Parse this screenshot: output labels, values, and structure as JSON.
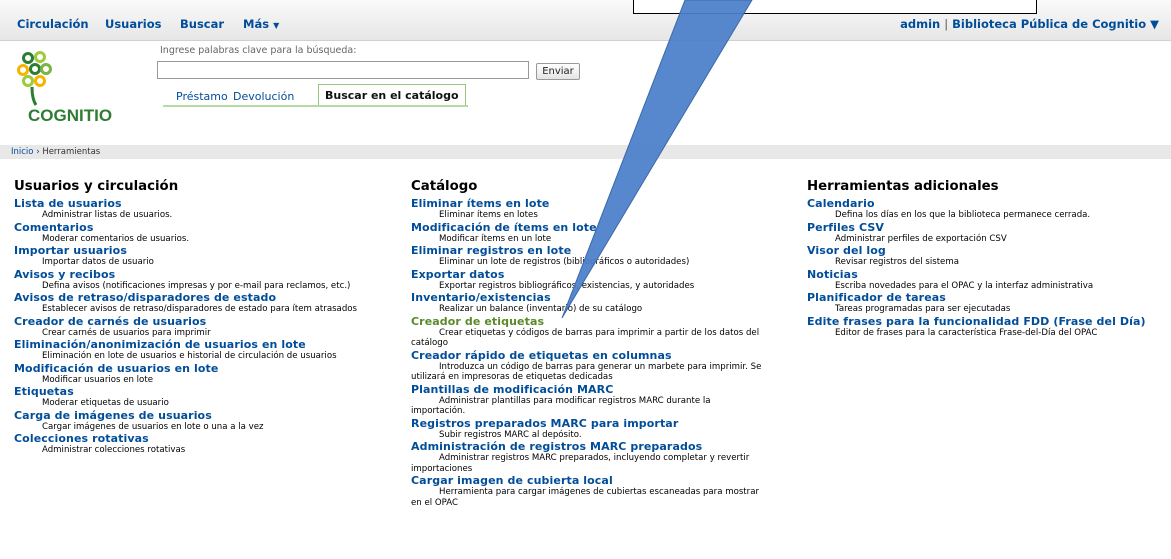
{
  "nav": {
    "circulacion": "Circulación",
    "usuarios": "Usuarios",
    "buscar": "Buscar",
    "mas": "Más",
    "user": "admin",
    "separator": "|",
    "library": "Biblioteca Pública de Cognitio"
  },
  "header": {
    "logo_text": "COGNITIO",
    "search_hint": "Ingrese palabras clave para la búsqueda:",
    "search_value": "",
    "submit": "Enviar",
    "tabs": [
      "Préstamo",
      "Devolución",
      "Buscar en el catálogo"
    ]
  },
  "breadcrumb": {
    "home": "Inicio",
    "sep": "›",
    "current": "Herramientas"
  },
  "columns": [
    {
      "title": "Usuarios y circulación",
      "items": [
        {
          "label": "Lista de usuarios",
          "desc": "Administrar listas de usuarios."
        },
        {
          "label": "Comentarios",
          "desc": "Moderar comentarios de usuarios."
        },
        {
          "label": "Importar usuarios",
          "desc": "Importar datos de usuario"
        },
        {
          "label": "Avisos y recibos",
          "desc": "Defina avisos (notificaciones impresas y por e-mail para reclamos, etc.)"
        },
        {
          "label": "Avisos de retraso/disparadores de estado",
          "desc": "Establecer avisos de retraso/disparadores de estado para ítem atrasados"
        },
        {
          "label": "Creador de carnés de usuarios",
          "desc": "Crear carnés de usuarios para imprimir"
        },
        {
          "label": "Eliminación/anonimización de usuarios en lote",
          "desc": "Eliminación en lote de usuarios e historial de circulación de usuarios"
        },
        {
          "label": "Modificación de usuarios en lote",
          "desc": "Modificar usuarios en lote"
        },
        {
          "label": "Etiquetas",
          "desc": "Moderar etiquetas de usuario"
        },
        {
          "label": "Carga de imágenes de usuarios",
          "desc": "Cargar imágenes de usuarios en lote o una a la vez"
        },
        {
          "label": "Colecciones rotativas",
          "desc": "Administrar colecciones rotativas"
        }
      ]
    },
    {
      "title": "Catálogo",
      "items": [
        {
          "label": "Eliminar ítems en lote",
          "desc": "Eliminar ítems en lotes"
        },
        {
          "label": "Modificación de ítems en lote",
          "desc": "Modificar ítems en un lote"
        },
        {
          "label": "Eliminar registros en lote",
          "desc": "Eliminar un lote de registros (bibliográficos o autoridades)"
        },
        {
          "label": "Exportar datos",
          "desc": "Exportar registros bibliográficos, existencias, y autoridades"
        },
        {
          "label": "Inventario/existencias",
          "desc": "Realizar un balance (inventario) de su catálogo"
        },
        {
          "label": "Creador de etiquetas",
          "desc": "Crear etiquetas y códigos de barras para imprimir a partir de los datos del catálogo",
          "highlight": true
        },
        {
          "label": "Creador rápido de etiquetas en columnas",
          "desc": "Introduzca un código de barras para generar un marbete para imprimir. Se utilizará en impresoras de etiquetas dedicadas"
        },
        {
          "label": "Plantillas de modificación MARC",
          "desc": "Administrar plantillas para modificar registros MARC durante la importación."
        },
        {
          "label": "Registros preparados MARC para importar",
          "desc": "Subir registros MARC al depósito."
        },
        {
          "label": "Administración de registros MARC preparados",
          "desc": "Administrar registros MARC preparados, incluyendo completar y revertir importaciones"
        },
        {
          "label": "Cargar imagen de cubierta local",
          "desc": "Herramienta para cargar imágenes de cubiertas escaneadas para mostrar en el OPAC"
        }
      ]
    },
    {
      "title": "Herramientas adicionales",
      "items": [
        {
          "label": "Calendario",
          "desc": "Defina los días en los que la biblioteca permanece cerrada."
        },
        {
          "label": "Perfiles CSV",
          "desc": "Administrar perfiles de exportación CSV"
        },
        {
          "label": "Visor del log",
          "desc": "Revisar registros del sistema"
        },
        {
          "label": "Noticias",
          "desc": "Escriba novedades para el OPAC y la interfaz administrativa"
        },
        {
          "label": "Planificador de tareas",
          "desc": "Tareas programadas para ser ejecutadas"
        },
        {
          "label": "Edite frases para la funcionalidad FDD (Frase del Día)",
          "desc": "Editor de frases para la característica Frase-del-Día del OPAC"
        }
      ]
    }
  ],
  "colors": {
    "link": "#004d99",
    "highlight_link": "#5a8a28",
    "arrow_fill": "#4a7ec8",
    "tab_border": "#95c67d"
  }
}
